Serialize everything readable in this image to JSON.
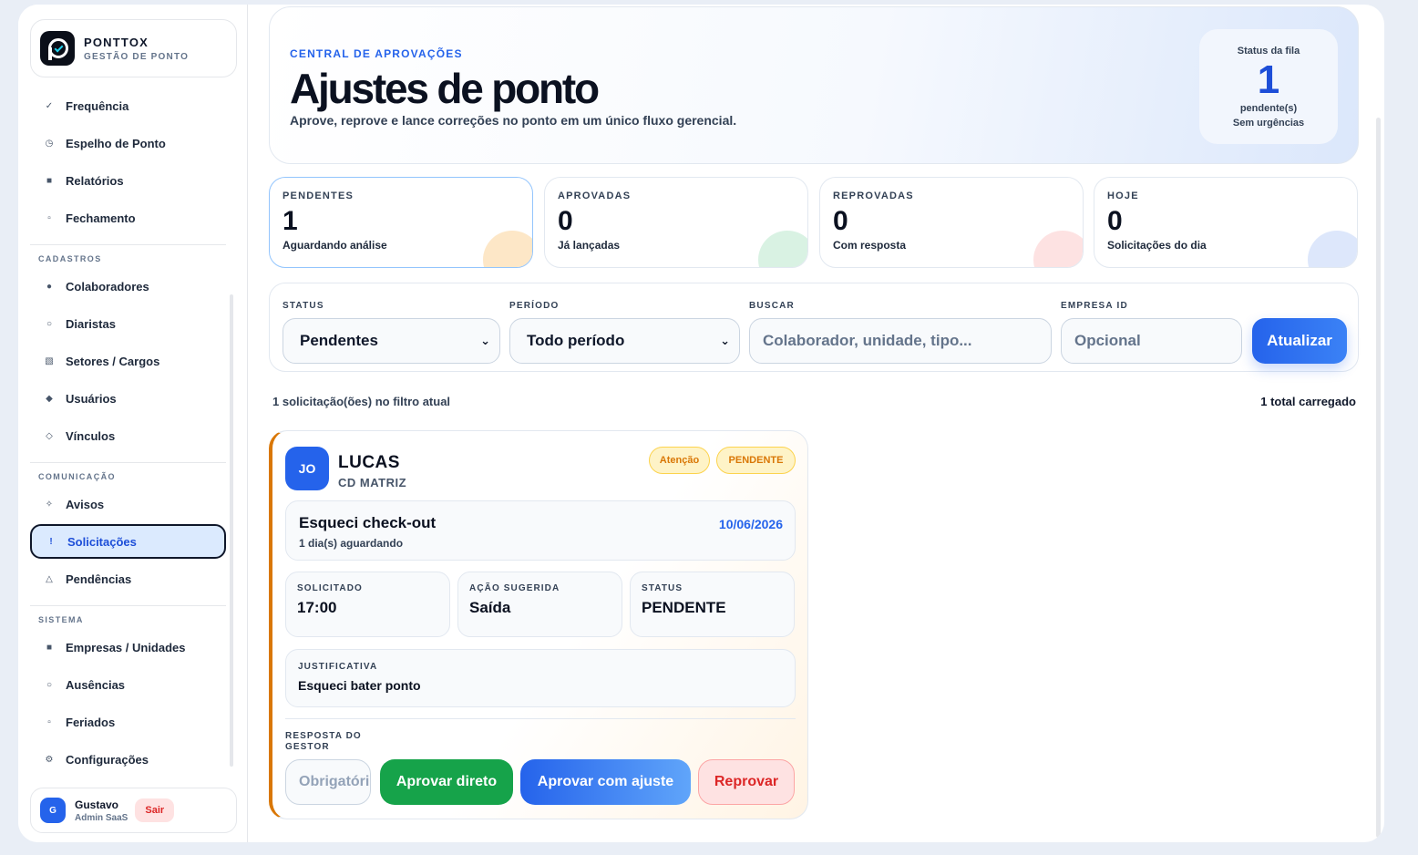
{
  "brand": {
    "name": "PONTTOX",
    "subtitle": "GESTÃO DE PONTO"
  },
  "nav": {
    "items_top": [
      {
        "label": "Frequência",
        "icon": "check-icon"
      },
      {
        "label": "Espelho de Ponto",
        "icon": "clock-icon"
      },
      {
        "label": "Relatórios",
        "icon": "square-icon"
      },
      {
        "label": "Fechamento",
        "icon": "square-outline-icon"
      }
    ],
    "section_cadastros": "CADASTROS",
    "items_cadastros": [
      {
        "label": "Colaboradores",
        "icon": "people-icon"
      },
      {
        "label": "Diaristas",
        "icon": "circle-icon"
      },
      {
        "label": "Setores / Cargos",
        "icon": "grid-icon"
      },
      {
        "label": "Usuários",
        "icon": "diamond-icon"
      },
      {
        "label": "Vínculos",
        "icon": "link-icon"
      }
    ],
    "section_comunicacao": "COMUNICAÇÃO",
    "items_comunicacao": [
      {
        "label": "Avisos",
        "icon": "sparkle-icon"
      },
      {
        "label": "Solicitações",
        "icon": "exclamation-icon",
        "active": true
      },
      {
        "label": "Pendências",
        "icon": "triangle-icon"
      }
    ],
    "section_sistema": "SISTEMA",
    "items_sistema": [
      {
        "label": "Empresas / Unidades",
        "icon": "building-icon"
      },
      {
        "label": "Ausências",
        "icon": "circle-icon"
      },
      {
        "label": "Feriados",
        "icon": "calendar-icon"
      },
      {
        "label": "Configurações",
        "icon": "gear-icon"
      }
    ]
  },
  "user": {
    "initial": "G",
    "name": "Gustavo",
    "role": "Admin SaaS",
    "logout": "Sair"
  },
  "header": {
    "eyebrow": "CENTRAL DE APROVAÇÕES",
    "title": "Ajustes de ponto",
    "subtitle": "Aprove, reprove e lance correções no ponto em um único fluxo gerencial.",
    "queue": {
      "label": "Status da fila",
      "count": "1",
      "unit": "pendente(s)",
      "note": "Sem urgências"
    }
  },
  "kpis": [
    {
      "label": "PENDENTES",
      "value": "1",
      "desc": "Aguardando análise",
      "color": "#fde7c7"
    },
    {
      "label": "APROVADAS",
      "value": "0",
      "desc": "Já lançadas",
      "color": "#d9f2e3"
    },
    {
      "label": "REPROVADAS",
      "value": "0",
      "desc": "Com resposta",
      "color": "#fde2e2"
    },
    {
      "label": "HOJE",
      "value": "0",
      "desc": "Solicitações do dia",
      "color": "#dde7fb"
    }
  ],
  "filters": {
    "status_label": "STATUS",
    "status_value": "Pendentes",
    "period_label": "PERÍODO",
    "period_value": "Todo período",
    "search_label": "BUSCAR",
    "search_placeholder": "Colaborador, unidade, tipo...",
    "company_label": "EMPRESA ID",
    "company_placeholder": "Opcional",
    "refresh": "Atualizar"
  },
  "results": {
    "count_text": "1 solicitação(ões) no filtro atual",
    "total_text": "1 total carregado"
  },
  "request": {
    "initials": "JO",
    "name": "LUCAS",
    "unit": "CD MATRIZ",
    "badge_attention": "Atenção",
    "badge_status": "PENDENTE",
    "title": "Esqueci check-out",
    "waiting": "1 dia(s) aguardando",
    "date": "10/06/2026",
    "requested_label": "SOLICITADO",
    "requested_value": "17:00",
    "action_label": "AÇÃO SUGERIDA",
    "action_value": "Saída",
    "status_label": "STATUS",
    "status_value": "PENDENTE",
    "justification_label": "JUSTIFICATIVA",
    "justification_value": "Esqueci bater ponto",
    "response_label": "RESPOSTA DO GESTOR",
    "response_placeholder": "Obrigatório",
    "approve_direct": "Aprovar direto",
    "approve_adjust": "Aprovar com ajuste",
    "reject": "Reprovar"
  }
}
